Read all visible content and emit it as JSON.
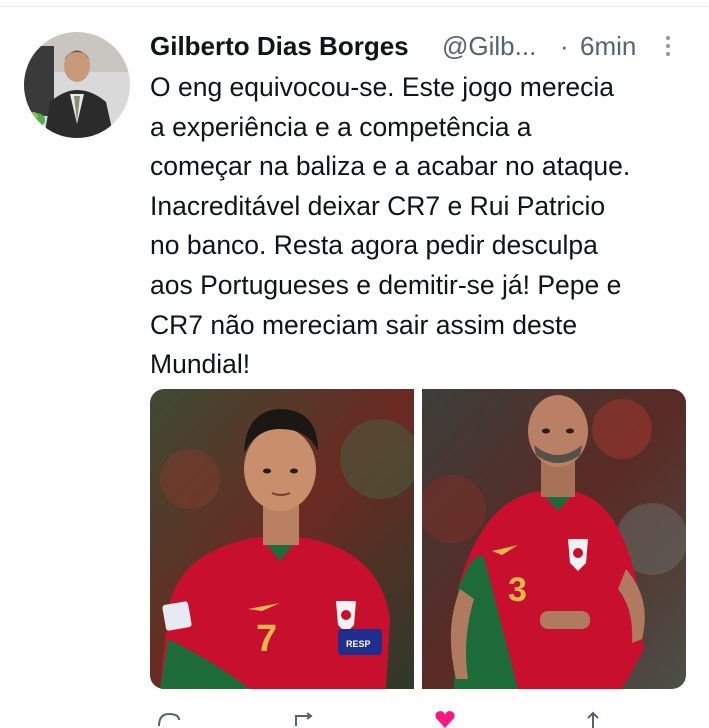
{
  "tweet": {
    "author_name": "Gilberto Dias Borges",
    "author_handle": "@Gilb...",
    "separator": "·",
    "timestamp": "6min",
    "text": "O eng equivocou-se. Este jogo merecia\na experiência e a competência a\ncomeçar na baliza e a acabar no ataque.\nInacreditável deixar CR7 e Rui Patricio\nno banco. Resta agora pedir desculpa\naos Portugueses e demitir-se já! Pepe e\nCR7 não mereciam sair assim deste\nMundial!",
    "media": [
      {
        "icon": "photo-player-7",
        "jersey_number": "7",
        "armband_text": "RESP"
      },
      {
        "icon": "photo-player-3",
        "jersey_number": "3"
      }
    ]
  },
  "colors": {
    "text_primary": "#0f1419",
    "text_secondary": "#536471",
    "jersey_red": "#c8102e",
    "jersey_green": "#1e6b3a",
    "like_pink": "#f91880"
  },
  "icons": {
    "more": "more-vertical-icon",
    "reply": "reply-icon",
    "retweet": "retweet-icon",
    "like": "heart-icon",
    "share": "share-icon"
  }
}
